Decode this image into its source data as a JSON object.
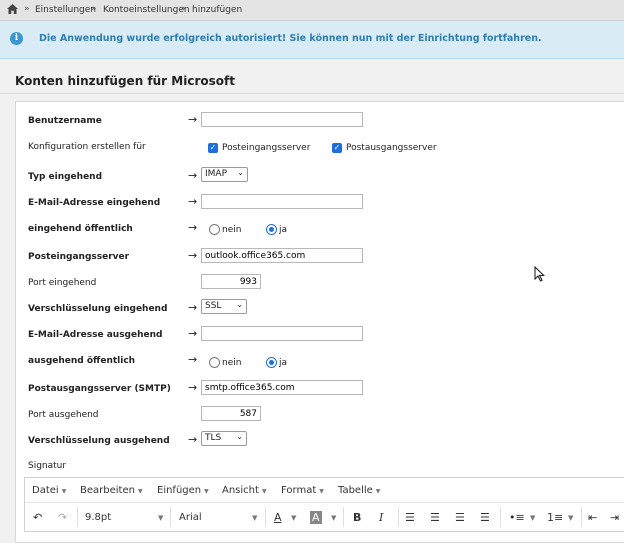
{
  "breadcrumb": {
    "items": [
      "Einstellungen",
      "Kontoeinstellungen",
      "hinzufügen"
    ]
  },
  "alert": {
    "message": "Die Anwendung wurde erfolgreich autorisiert! Sie können nun mit der Einrichtung fortfahren."
  },
  "panel": {
    "title": "Konten hinzufügen für Microsoft"
  },
  "form": {
    "username": {
      "label": "Benutzername",
      "value": ""
    },
    "config": {
      "label": "Konfiguration erstellen für",
      "incoming_label": "Posteingangsserver",
      "outgoing_label": "Postausgangsserver"
    },
    "incoming_type": {
      "label": "Typ eingehend",
      "value": "IMAP"
    },
    "incoming_email": {
      "label": "E-Mail-Adresse eingehend",
      "value": ""
    },
    "incoming_public": {
      "label": "eingehend öffentlich",
      "no": "nein",
      "yes": "ja",
      "selected": "ja"
    },
    "incoming_server": {
      "label": "Posteingangsserver",
      "value": "outlook.office365.com"
    },
    "incoming_port": {
      "label": "Port eingehend",
      "value": "993"
    },
    "incoming_encryption": {
      "label": "Verschlüsselung eingehend",
      "value": "SSL"
    },
    "outgoing_email": {
      "label": "E-Mail-Adresse ausgehend",
      "value": ""
    },
    "outgoing_public": {
      "label": "ausgehend öffentlich",
      "no": "nein",
      "yes": "ja",
      "selected": "ja"
    },
    "outgoing_server": {
      "label": "Postausgangsserver (SMTP)",
      "value": "smtp.office365.com"
    },
    "outgoing_port": {
      "label": "Port ausgehend",
      "value": "587"
    },
    "outgoing_encryption": {
      "label": "Verschlüsselung ausgehend",
      "value": "TLS"
    },
    "signature": {
      "label": "Signatur"
    }
  },
  "editor": {
    "menus": [
      "Datei",
      "Bearbeiten",
      "Einfügen",
      "Ansicht",
      "Format",
      "Tabelle"
    ],
    "font_size": "9.8pt",
    "font_family": "Arial",
    "bold": "B",
    "italic": "I"
  },
  "colors": {
    "alert_bg": "#d9ecf6",
    "alert_text": "#2f7eb0",
    "accent": "#1e6fd9"
  },
  "icons": {
    "home": "home-icon",
    "info": "info-icon",
    "arrow": "right-arrow-icon",
    "checkbox": "checkbox-checked-icon",
    "cursor": "mouse-pointer-icon"
  }
}
